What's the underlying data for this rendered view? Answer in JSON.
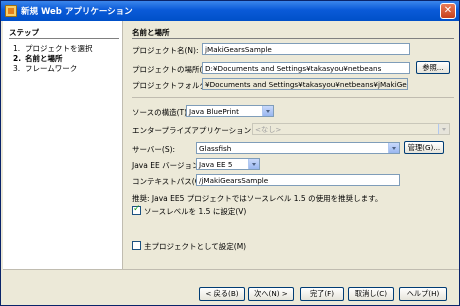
{
  "window": {
    "title": "新規 Web アプリケーション",
    "icon": "netbeans-project-icon",
    "close_icon": "close-icon"
  },
  "steps": {
    "title": "ステップ",
    "items": [
      {
        "num": "1.",
        "label": "プロジェクトを選択"
      },
      {
        "num": "2.",
        "label": "名前と場所"
      },
      {
        "num": "3.",
        "label": "フレームワーク"
      }
    ]
  },
  "form": {
    "section_title": "名前と場所",
    "project_name_label": "プロジェクト名(N):",
    "project_name_value": "jMakiGearsSample",
    "project_location_label": "プロジェクトの場所(L):",
    "project_location_value": "D:¥Documents and Settings¥takasyou¥netbeans",
    "browse_label": "参照...",
    "project_folder_label": "プロジェクトフォルダ(D):",
    "project_folder_value": "¥Documents and Settings¥takasyou¥netbeans¥jMakiGearsSample",
    "source_structure_label": "ソースの構造(T):",
    "source_structure_value": "Java BluePrint",
    "enterprise_app_label": "エンタープライズアプリケーションに追加(A):",
    "enterprise_app_value": "<なし>",
    "server_label": "サーバー(S):",
    "server_value": "Glassfish",
    "manage_label": "管理(G)...",
    "javaee_label": "Java EE バージョン:",
    "javaee_value": "Java EE 5",
    "context_path_label": "コンテキストパス(C):",
    "context_path_value": "/jMakiGearsSample",
    "recommendation_text": "推奨: Java EE5 プロジェクトではソースレベル 1.5 の使用を推奨します。",
    "source_level_checkbox_label": "ソースレベルを 1.5 に設定(V)",
    "source_level_checked": true,
    "main_project_checkbox_label": "主プロジェクトとして設定(M)",
    "main_project_checked": false
  },
  "footer": {
    "back_label": "< 戻る(B)",
    "next_label": "次へ(N) >",
    "finish_label": "完了(F)",
    "cancel_label": "取消し(C)",
    "help_label": "ヘルプ(H)"
  },
  "colors": {
    "titlebar": "#0a5ad8",
    "panel_bg": "#ece9d8",
    "field_border": "#7f9db9"
  }
}
